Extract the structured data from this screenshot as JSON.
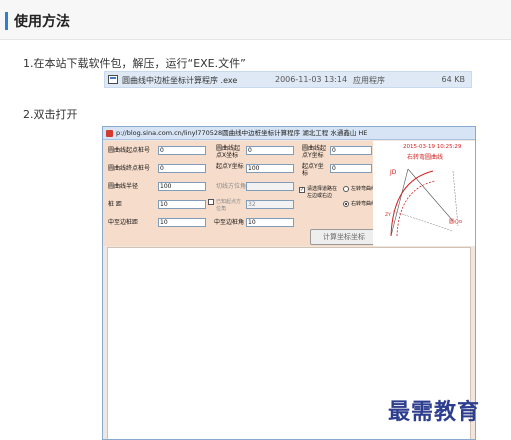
{
  "section": {
    "title": "使用方法"
  },
  "steps": {
    "step1": "1.在本站下载软件包，解压，运行“EXE.文件”",
    "step2": "2.双击打开"
  },
  "file": {
    "name": "圆曲线中边桩坐标计算程序 .exe",
    "date": "2006-11-03 13:14",
    "type": "应用程序",
    "size": "64 KB"
  },
  "app": {
    "title": "p://blog.sina.com.cn/linyl770528圆曲线中边桩坐标计算程序   湖北工程  水通鑫山  HE",
    "labels": {
      "start_pile": "圆曲线起点桩号",
      "end_pile": "圆曲线终点桩号",
      "radius": "圆曲线半径",
      "spacing": "桩  距",
      "edge_dist": "中至边桩距",
      "start_x": "圆曲线起点X坐标",
      "start_y": "起点Y坐标",
      "xfactor": "切线方位角",
      "tangent_az": "已知起点方位角",
      "edge_az": "中至边桩角",
      "end_x": "圆曲线起点Y坐标",
      "end_y": "起点Y坐标",
      "check_label": "请选择道路在左边或右边",
      "turn_left": "左转弯曲线",
      "turn_right": "右转弯曲线"
    },
    "values": {
      "start_pile": "0",
      "end_pile": "0",
      "radius": "100",
      "spacing": "10",
      "edge_dist": "10",
      "start_x": "0",
      "start_y": "100",
      "tangent_az": "32",
      "edge_az": "10",
      "end_x": "0",
      "end_y": "0"
    },
    "calc_button": "计算坐标坐标",
    "diagram": {
      "timestamp": "2015-03-19 10:25:29",
      "title": "右转弯圆曲线",
      "jd": "JD",
      "zy": "ZY",
      "center": "圆心o"
    }
  },
  "watermark": "最需教育",
  "colors": {
    "accent": "#2f7fd1",
    "form_bg": "#f6dccb",
    "diagram_red": "#d21f1f"
  }
}
